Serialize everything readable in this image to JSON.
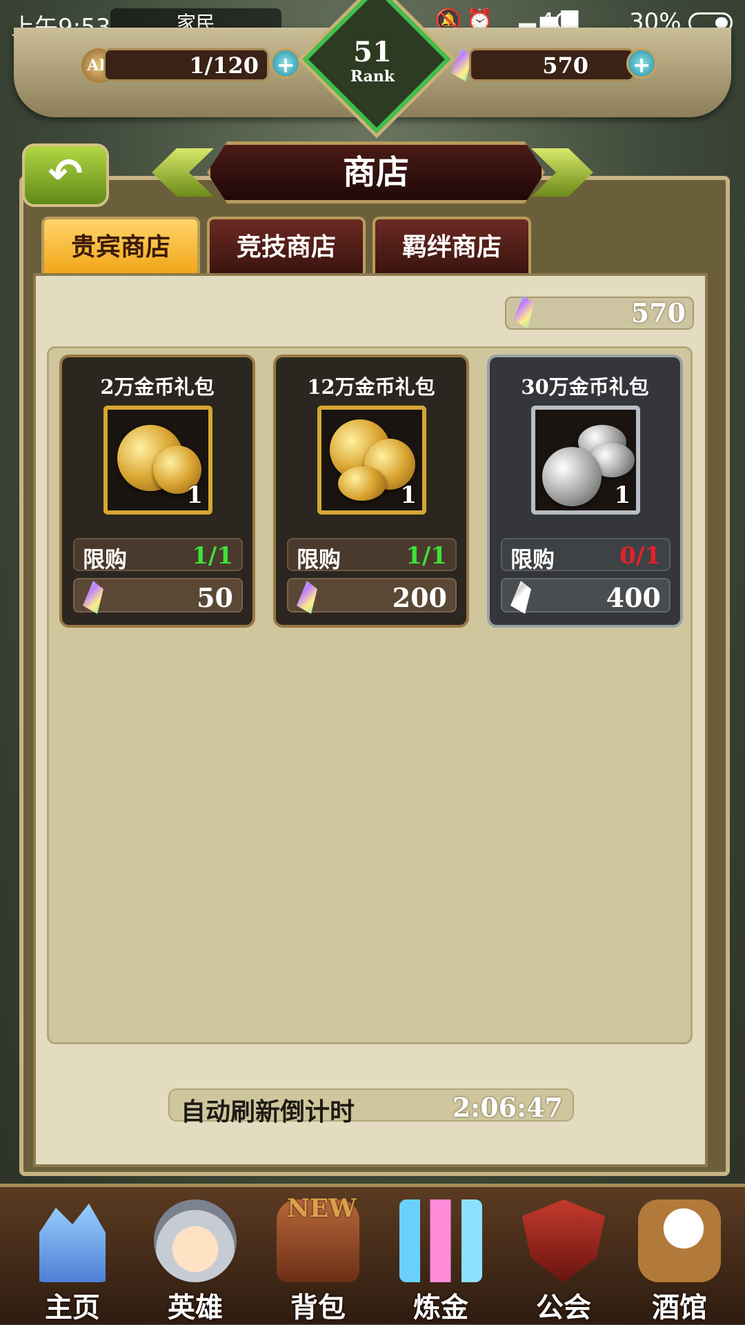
{
  "status_bar": {
    "time": "上午9:53",
    "carrier": "家民",
    "network": "4G",
    "battery": "30%"
  },
  "top_bar": {
    "ap_icon_label": "AP",
    "ap_value": "1/120",
    "crystals_value": "570",
    "rank_number": "51",
    "rank_label": "Rank"
  },
  "header": {
    "title": "商店",
    "back_icon": "back-arrow-icon"
  },
  "tabs": [
    {
      "label": "贵宾商店",
      "active": true
    },
    {
      "label": "竞技商店",
      "active": false
    },
    {
      "label": "羁绊商店",
      "active": false
    }
  ],
  "shop": {
    "currency_value": "570",
    "items": [
      {
        "title": "2万金币礼包",
        "quantity": "1",
        "limit_label": "限购",
        "limit_value": "1/1",
        "limit_color": "#3ee03a",
        "price": "50",
        "available": true
      },
      {
        "title": "12万金币礼包",
        "quantity": "1",
        "limit_label": "限购",
        "limit_value": "1/1",
        "limit_color": "#3ee03a",
        "price": "200",
        "available": true
      },
      {
        "title": "30万金币礼包",
        "quantity": "1",
        "limit_label": "限购",
        "limit_value": "0/1",
        "limit_color": "#e8202a",
        "price": "400",
        "available": false
      }
    ],
    "refresh_label": "自动刷新倒计时",
    "refresh_time": "2:06:47"
  },
  "bottom_nav": [
    {
      "label": "主页",
      "icon": "castle-icon"
    },
    {
      "label": "英雄",
      "icon": "hero-helmet-icon"
    },
    {
      "label": "背包",
      "icon": "backpack-icon",
      "badge": "NEW"
    },
    {
      "label": "炼金",
      "icon": "potion-flasks-icon"
    },
    {
      "label": "公会",
      "icon": "guild-shield-icon"
    },
    {
      "label": "酒馆",
      "icon": "tavern-beer-icon"
    }
  ],
  "colors": {
    "accent_tab_active": "#f1a414",
    "available_limit": "#3ee03a",
    "soldout_limit": "#e8202a"
  }
}
